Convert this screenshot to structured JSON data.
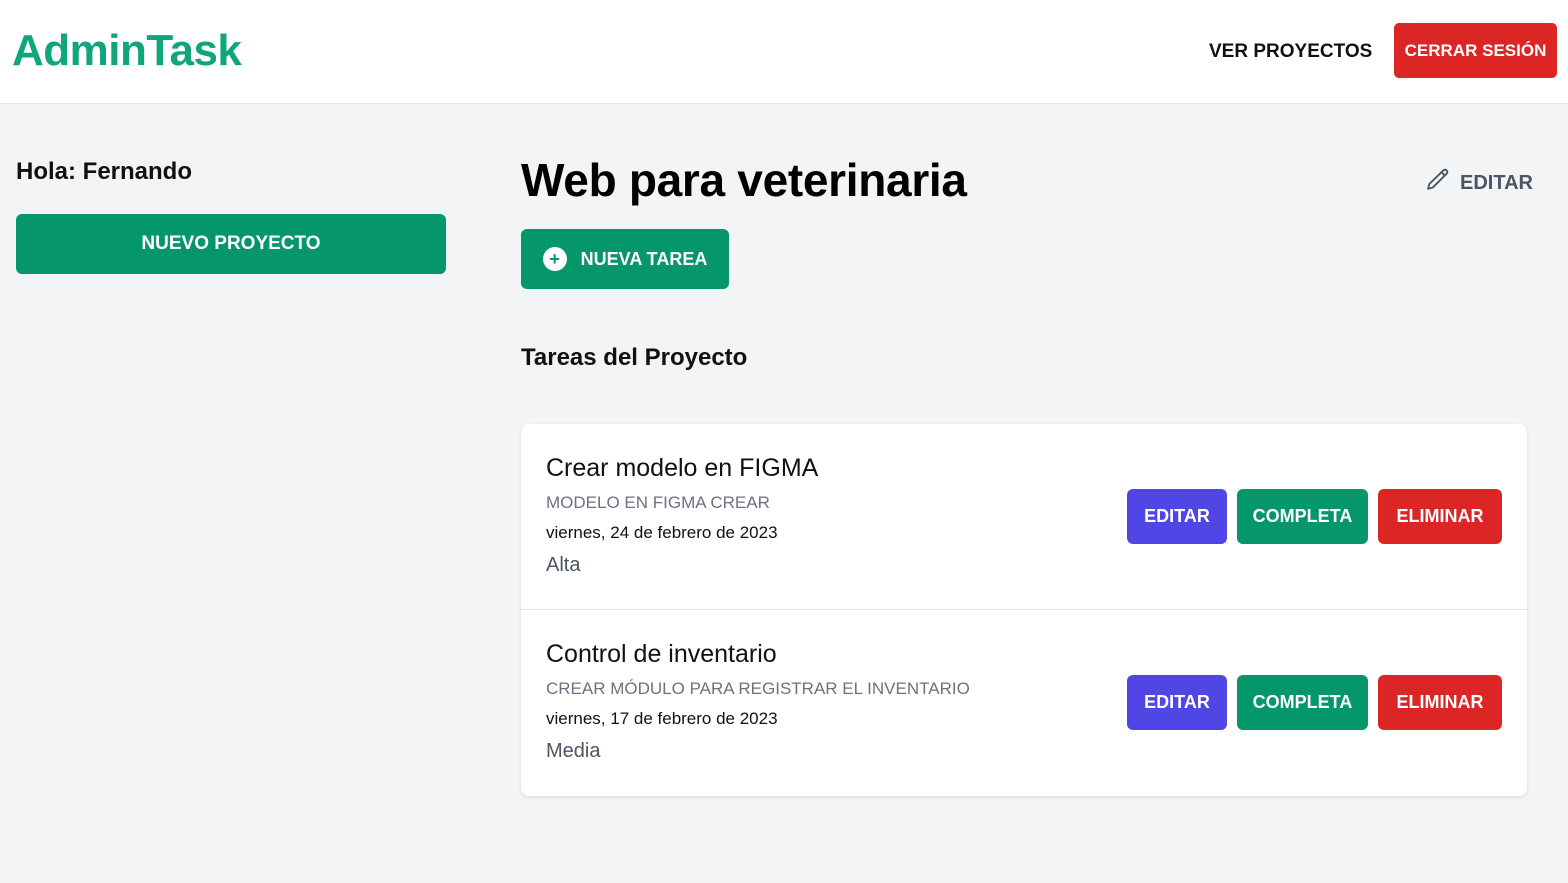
{
  "header": {
    "logo": "AdminTask",
    "nav_projects": "VER PROYECTOS",
    "logout": "CERRAR SESIÓN"
  },
  "sidebar": {
    "greeting": "Hola: Fernando",
    "new_project": "NUEVO PROYECTO"
  },
  "project": {
    "title": "Web para veterinaria",
    "edit_label": "EDITAR",
    "new_task": "NUEVA TAREA",
    "tasks_heading": "Tareas del Proyecto"
  },
  "tasks": [
    {
      "name": "Crear modelo en FIGMA",
      "description": "MODELO EN FIGMA CREAR",
      "date": "viernes, 24 de febrero de 2023",
      "priority": "Alta",
      "edit": "EDITAR",
      "complete": "COMPLETA",
      "delete": "ELIMINAR"
    },
    {
      "name": "Control de inventario",
      "description": "CREAR MÓDULO PARA REGISTRAR EL INVENTARIO",
      "date": "viernes, 17 de febrero de 2023",
      "priority": "Media",
      "edit": "EDITAR",
      "complete": "COMPLETA",
      "delete": "ELIMINAR"
    }
  ],
  "colors": {
    "brand": "#0ea67a",
    "primary": "#059669",
    "danger": "#dc2626",
    "edit": "#4f46e5",
    "background": "#f3f4f6"
  },
  "icons": {
    "edit_project": "pencil-icon",
    "new_task": "plus-circle-icon"
  }
}
